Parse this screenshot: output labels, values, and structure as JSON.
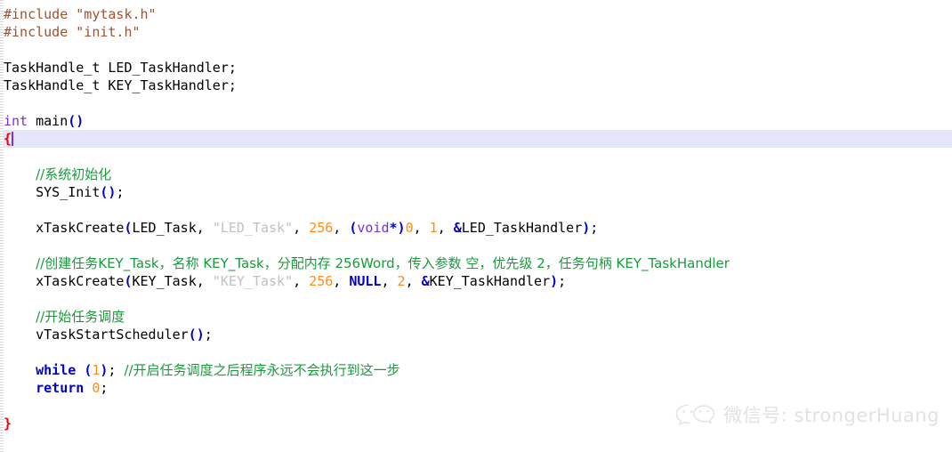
{
  "editor": {
    "language": "c",
    "current_line_index": 6,
    "colors": {
      "background": "#ffffff",
      "current_line_highlight": "#e4e4fb",
      "preprocessor": "#a0522d",
      "string_brown": "#a0522d",
      "string_gray": "#c0c0c0",
      "keyword": "#0000cc",
      "type": "#7a2fd4",
      "number": "#ff8c1a",
      "comment": "#1a9a3c",
      "brace_unmatched": "#ee0000",
      "caret": "#7a2fd4",
      "watermark": "#e2e2e2"
    }
  },
  "code": {
    "lines": [
      {
        "id": "include-mytask",
        "tokens": [
          {
            "t": "#include ",
            "c": "pre"
          },
          {
            "t": "\"mytask.h\"",
            "c": "str-br"
          }
        ]
      },
      {
        "id": "include-init",
        "tokens": [
          {
            "t": "#include ",
            "c": "pre"
          },
          {
            "t": "\"init.h\"",
            "c": "str-br"
          }
        ]
      },
      {
        "id": "blank-1",
        "tokens": []
      },
      {
        "id": "decl-led-handler",
        "tokens": [
          {
            "t": "TaskHandle_t LED_TaskHandler",
            "c": "plain"
          },
          {
            "t": ";",
            "c": "plain"
          }
        ]
      },
      {
        "id": "decl-key-handler",
        "tokens": [
          {
            "t": "TaskHandle_t KEY_TaskHandler",
            "c": "plain"
          },
          {
            "t": ";",
            "c": "plain"
          }
        ]
      },
      {
        "id": "blank-2",
        "tokens": []
      },
      {
        "id": "main-signature",
        "tokens": [
          {
            "t": "int",
            "c": "type"
          },
          {
            "t": " main",
            "c": "plain"
          },
          {
            "t": "()",
            "c": "punct"
          }
        ]
      },
      {
        "id": "open-brace",
        "current": true,
        "caret": true,
        "tokens": [
          {
            "t": "{",
            "c": "brace-red"
          }
        ]
      },
      {
        "id": "blank-3",
        "tokens": []
      },
      {
        "id": "comment-sys-init",
        "tokens": [
          {
            "t": "    ",
            "c": "plain"
          },
          {
            "t": "//系统初始化",
            "c": "cmt cn"
          }
        ]
      },
      {
        "id": "call-sys-init",
        "tokens": [
          {
            "t": "    SYS_Init",
            "c": "plain"
          },
          {
            "t": "()",
            "c": "punct"
          },
          {
            "t": ";",
            "c": "plain"
          }
        ]
      },
      {
        "id": "blank-4",
        "tokens": []
      },
      {
        "id": "call-xtaskcreate-led",
        "tokens": [
          {
            "t": "    xTaskCreate",
            "c": "plain"
          },
          {
            "t": "(",
            "c": "punct"
          },
          {
            "t": "LED_Task, ",
            "c": "plain"
          },
          {
            "t": "\"LED_Task\"",
            "c": "str-gray"
          },
          {
            "t": ", ",
            "c": "plain"
          },
          {
            "t": "256",
            "c": "num"
          },
          {
            "t": ", ",
            "c": "plain"
          },
          {
            "t": "(",
            "c": "punct"
          },
          {
            "t": "void",
            "c": "type"
          },
          {
            "t": "*)",
            "c": "punct"
          },
          {
            "t": "0",
            "c": "num"
          },
          {
            "t": ", ",
            "c": "plain"
          },
          {
            "t": "1",
            "c": "num"
          },
          {
            "t": ", ",
            "c": "plain"
          },
          {
            "t": "&",
            "c": "punct"
          },
          {
            "t": "LED_TaskHandler",
            "c": "plain"
          },
          {
            "t": ")",
            "c": "punct"
          },
          {
            "t": ";",
            "c": "plain"
          }
        ]
      },
      {
        "id": "blank-5",
        "tokens": []
      },
      {
        "id": "comment-key-task",
        "tokens": [
          {
            "t": "    ",
            "c": "plain"
          },
          {
            "t": "//创建任务KEY_Task，名称 KEY_Task，分配内存 256Word，传入参数 空，优先级 2，任务句柄 KEY_TaskHandler",
            "c": "cmt cn"
          }
        ]
      },
      {
        "id": "call-xtaskcreate-key",
        "tokens": [
          {
            "t": "    xTaskCreate",
            "c": "plain"
          },
          {
            "t": "(",
            "c": "punct"
          },
          {
            "t": "KEY_Task, ",
            "c": "plain"
          },
          {
            "t": "\"KEY_Task\"",
            "c": "str-gray"
          },
          {
            "t": ", ",
            "c": "plain"
          },
          {
            "t": "256",
            "c": "num"
          },
          {
            "t": ", ",
            "c": "plain"
          },
          {
            "t": "NULL",
            "c": "kw"
          },
          {
            "t": ", ",
            "c": "plain"
          },
          {
            "t": "2",
            "c": "num"
          },
          {
            "t": ", ",
            "c": "plain"
          },
          {
            "t": "&",
            "c": "punct"
          },
          {
            "t": "KEY_TaskHandler",
            "c": "plain"
          },
          {
            "t": ")",
            "c": "punct"
          },
          {
            "t": ";",
            "c": "plain"
          }
        ]
      },
      {
        "id": "blank-6",
        "tokens": []
      },
      {
        "id": "comment-start-scheduler",
        "tokens": [
          {
            "t": "    ",
            "c": "plain"
          },
          {
            "t": "//开始任务调度",
            "c": "cmt cn"
          }
        ]
      },
      {
        "id": "call-vtaskstartscheduler",
        "tokens": [
          {
            "t": "    vTaskStartScheduler",
            "c": "plain"
          },
          {
            "t": "()",
            "c": "punct"
          },
          {
            "t": ";",
            "c": "plain"
          }
        ]
      },
      {
        "id": "blank-7",
        "tokens": []
      },
      {
        "id": "while-loop",
        "tokens": [
          {
            "t": "    ",
            "c": "plain"
          },
          {
            "t": "while",
            "c": "kw"
          },
          {
            "t": " ",
            "c": "plain"
          },
          {
            "t": "(",
            "c": "punct"
          },
          {
            "t": "1",
            "c": "num"
          },
          {
            "t": ")",
            "c": "punct"
          },
          {
            "t": "; ",
            "c": "plain"
          },
          {
            "t": "//开启任务调度之后程序永远不会执行到这一步",
            "c": "cmt cn"
          }
        ]
      },
      {
        "id": "return-zero",
        "tokens": [
          {
            "t": "    ",
            "c": "plain"
          },
          {
            "t": "return",
            "c": "kw"
          },
          {
            "t": " ",
            "c": "plain"
          },
          {
            "t": "0",
            "c": "num"
          },
          {
            "t": ";",
            "c": "plain"
          }
        ]
      },
      {
        "id": "blank-8",
        "tokens": []
      },
      {
        "id": "close-brace",
        "tokens": [
          {
            "t": "}",
            "c": "brace-red"
          }
        ]
      }
    ]
  },
  "watermark": {
    "icon": "wechat-logo-icon",
    "text": "微信号: strongerHuang"
  }
}
